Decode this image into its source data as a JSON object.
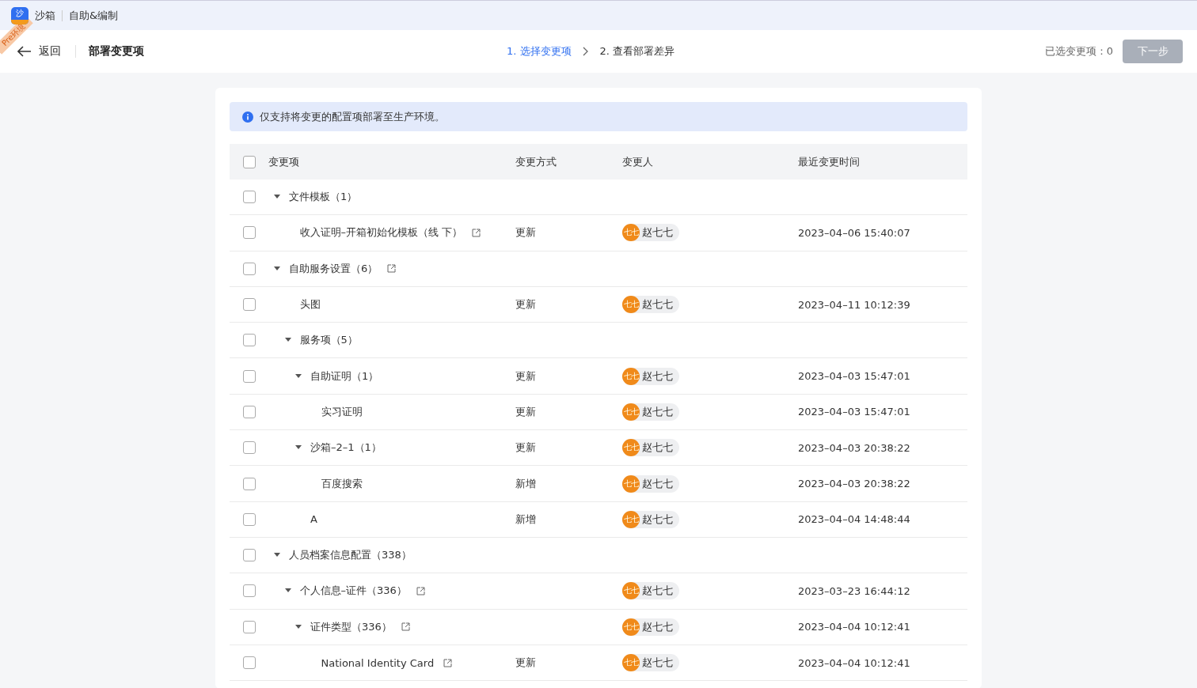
{
  "app": {
    "logo_text": "沙",
    "name": "沙箱",
    "module": "自助&编制",
    "env_ribbon": "Pre环境"
  },
  "header": {
    "back": "返回",
    "title": "部署变更项",
    "steps": [
      {
        "label": "1. 选择变更项",
        "selected": true
      },
      {
        "label": "2. 查看部署差异",
        "selected": false
      }
    ],
    "selected_count": "已选变更项：0",
    "next_button": {
      "label": "下一步",
      "disabled": true
    }
  },
  "notice": "仅支持将变更的配置项部署至生产环境。",
  "table": {
    "columns": [
      "变更项",
      "变更方式",
      "变更人",
      "最近变更时间"
    ],
    "header_checked": false,
    "rows": [
      {
        "name": "文件模板（1）",
        "checked": false,
        "expanded": true,
        "children": [
          {
            "name": "收入证明–开箱初始化模板（线 下）",
            "link": true,
            "checked": false,
            "method": "更新",
            "person": "赵七七",
            "avatar": "七七",
            "time": "2023–04–06 15:40:07"
          }
        ]
      },
      {
        "name": "自助服务设置（6）",
        "link": true,
        "checked": false,
        "expanded": true,
        "children": [
          {
            "name": "头图",
            "checked": false,
            "method": "更新",
            "person": "赵七七",
            "avatar": "七七",
            "time": "2023–04–11 10:12:39"
          },
          {
            "name": "服务项（5）",
            "checked": false,
            "expanded": true,
            "children": [
              {
                "name": "自助证明（1）",
                "checked": false,
                "expanded": true,
                "method": "更新",
                "person": "赵七七",
                "avatar": "七七",
                "time": "2023–04–03 15:47:01",
                "children": [
                  {
                    "name": "实习证明",
                    "checked": false,
                    "method": "更新",
                    "person": "赵七七",
                    "avatar": "七七",
                    "time": "2023–04–03 15:47:01"
                  }
                ]
              },
              {
                "name": "沙箱–2–1（1）",
                "checked": false,
                "expanded": true,
                "method": "更新",
                "person": "赵七七",
                "avatar": "七七",
                "time": "2023–04–03 20:38:22",
                "children": [
                  {
                    "name": "百度搜索",
                    "checked": false,
                    "method": "新增",
                    "person": "赵七七",
                    "avatar": "七七",
                    "time": "2023–04–03 20:38:22"
                  }
                ]
              },
              {
                "name": "A",
                "checked": false,
                "method": "新增",
                "person": "赵七七",
                "avatar": "七七",
                "time": "2023–04–04 14:48:44"
              }
            ]
          }
        ]
      },
      {
        "name": "人员档案信息配置（338）",
        "checked": false,
        "expanded": true,
        "children": [
          {
            "name": "个人信息–证件（336）",
            "link": true,
            "checked": false,
            "expanded": true,
            "person": "赵七七",
            "avatar": "七七",
            "time": "2023–03–23 16:44:12",
            "children": [
              {
                "name": "证件类型（336）",
                "link": true,
                "checked": false,
                "expanded": true,
                "person": "赵七七",
                "avatar": "七七",
                "time": "2023–04–04 10:12:41",
                "children": [
                  {
                    "name": "National Identity Card",
                    "link": true,
                    "checked": false,
                    "method": "更新",
                    "person": "赵七七",
                    "avatar": "七七",
                    "time": "2023–04–04 10:12:41"
                  }
                ]
              }
            ]
          }
        ]
      }
    ]
  }
}
